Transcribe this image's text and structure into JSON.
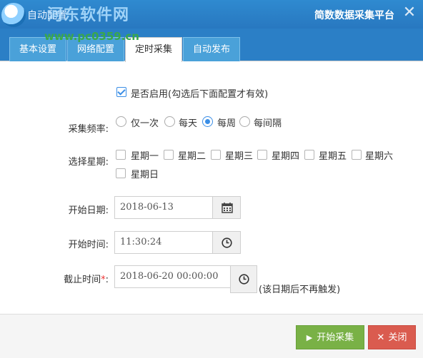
{
  "window": {
    "title_left": "自动配置",
    "title_right": "简数数据采集平台",
    "watermark_cn": "河东软件网",
    "watermark_url": "www.pc0359.cn"
  },
  "tabs": [
    {
      "label": "基本设置",
      "active": false
    },
    {
      "label": "网络配置",
      "active": false
    },
    {
      "label": "定时采集",
      "active": true
    },
    {
      "label": "自动发布",
      "active": false
    }
  ],
  "form": {
    "enable": {
      "label": "是否启用(勾选后下面配置才有效)",
      "checked": true
    },
    "frequency": {
      "label": "采集频率:",
      "options": [
        "仅一次",
        "每天",
        "每周",
        "每间隔"
      ],
      "selected": "每周"
    },
    "weekdays": {
      "label": "选择星期:",
      "options": [
        "星期一",
        "星期二",
        "星期三",
        "星期四",
        "星期五",
        "星期六",
        "星期日"
      ]
    },
    "start_date": {
      "label": "开始日期:",
      "value": "2018-06-13",
      "icon": "calendar-icon"
    },
    "start_time": {
      "label": "开始时间:",
      "value": "11:30:24",
      "icon": "clock-icon"
    },
    "end_time": {
      "label": "截止时间",
      "required_mark": "*",
      "colon": ":",
      "value": "2018-06-20 00:00:00",
      "hint": "(该日期后不再触发)",
      "icon": "clock-icon"
    }
  },
  "footer": {
    "start_label": "开始采集",
    "close_label": "关闭",
    "start_color": "#79b146",
    "close_color": "#da5b4f"
  }
}
